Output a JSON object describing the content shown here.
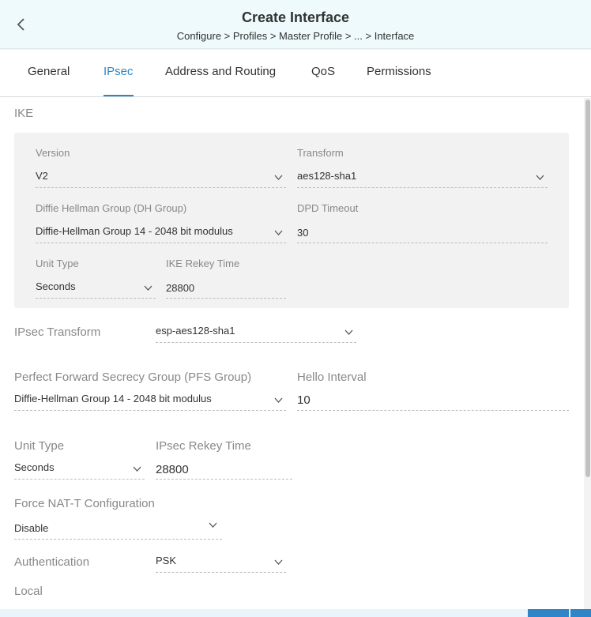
{
  "header": {
    "title": "Create Interface",
    "breadcrumb": "Configure > Profiles > Master Profile > ... > Interface"
  },
  "tabs": [
    {
      "label": "General"
    },
    {
      "label": "IPsec"
    },
    {
      "label": "Address and Routing"
    },
    {
      "label": "QoS"
    },
    {
      "label": "Permissions"
    }
  ],
  "active_tab": "IPsec",
  "ike": {
    "section_title": "IKE",
    "version": {
      "label": "Version",
      "value": "V2"
    },
    "transform": {
      "label": "Transform",
      "value": "aes128-sha1"
    },
    "dh_group": {
      "label": "Diffie Hellman Group (DH Group)",
      "value": "Diffie-Hellman Group 14 - 2048 bit modulus"
    },
    "dpd_timeout": {
      "label": "DPD Timeout",
      "value": "30"
    },
    "unit_type": {
      "label": "Unit Type",
      "value": "Seconds"
    },
    "rekey_time": {
      "label": "IKE Rekey Time",
      "value": "28800"
    }
  },
  "ipsec": {
    "transform": {
      "label": "IPsec Transform",
      "value": "esp-aes128-sha1"
    },
    "pfs_group": {
      "label": "Perfect Forward Secrecy Group (PFS Group)",
      "value": "Diffie-Hellman Group 14 - 2048 bit modulus"
    },
    "hello_interval": {
      "label": "Hello Interval",
      "value": "10"
    },
    "unit_type": {
      "label": "Unit Type",
      "value": "Seconds"
    },
    "rekey_time": {
      "label": "IPsec Rekey Time",
      "value": "28800"
    },
    "nat_t": {
      "label": "Force NAT-T Configuration",
      "value": "Disable"
    },
    "authentication": {
      "label": "Authentication",
      "value": "PSK"
    },
    "local_title": "Local"
  },
  "colors": {
    "accent": "#2e86c8",
    "header_bg": "#eefafc",
    "panel_bg": "#f2f2f2"
  }
}
